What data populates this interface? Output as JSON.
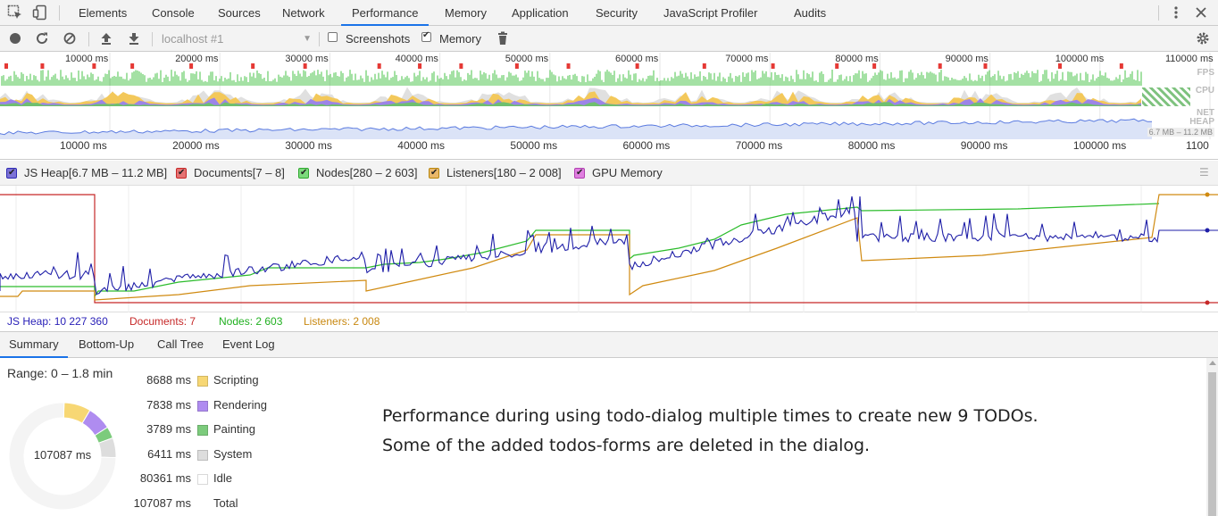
{
  "tabs": [
    {
      "label": "Elements"
    },
    {
      "label": "Console"
    },
    {
      "label": "Sources"
    },
    {
      "label": "Network"
    },
    {
      "label": "Performance"
    },
    {
      "label": "Memory"
    },
    {
      "label": "Application"
    },
    {
      "label": "Security"
    },
    {
      "label": "JavaScript Profiler"
    },
    {
      "label": "Audits"
    }
  ],
  "active_tab": "Performance",
  "toolbar": {
    "target": "localhost #1",
    "screenshots_label": "Screenshots",
    "screenshots_checked": false,
    "memory_label": "Memory",
    "memory_checked": true
  },
  "overview": {
    "ticks": [
      "10000 ms",
      "20000 ms",
      "30000 ms",
      "40000 ms",
      "50000 ms",
      "60000 ms",
      "70000 ms",
      "80000 ms",
      "90000 ms",
      "100000 ms",
      "110000 ms"
    ],
    "bottom_ticks": [
      "10000 ms",
      "20000 ms",
      "30000 ms",
      "40000 ms",
      "50000 ms",
      "60000 ms",
      "70000 ms",
      "80000 ms",
      "90000 ms",
      "100000 ms",
      "1100"
    ],
    "fps_label": "FPS",
    "cpu_label": "CPU",
    "net_label": "NET",
    "heap_label": "HEAP",
    "heap_range": "6.7 MB – 11.2 MB"
  },
  "legend": {
    "items": [
      {
        "label": "JS Heap[6.7 MB – 11.2 MB]",
        "color": "#2e2ab3",
        "checked": true
      },
      {
        "label": "Documents[7 – 8]",
        "color": "#d9534f",
        "checked": true
      },
      {
        "label": "Nodes[280 – 2 603]",
        "color": "#4cd964",
        "checked": true
      },
      {
        "label": "Listeners[180 – 2 008]",
        "color": "#e0a83c",
        "checked": true
      },
      {
        "label": "GPU Memory",
        "color": "#d65bd6",
        "checked": true
      }
    ]
  },
  "counters": {
    "js_heap": "JS Heap: 10 227 360",
    "documents": "Documents: 7",
    "nodes": "Nodes: 2 603",
    "listeners": "Listeners: 2 008"
  },
  "subtabs": [
    "Summary",
    "Bottom-Up",
    "Call Tree",
    "Event Log"
  ],
  "summary": {
    "range": "Range: 0 – 1.8 min",
    "total_center": "107087 ms",
    "rows": [
      {
        "value": "8688 ms",
        "name": "Scripting",
        "color": "#f7d774"
      },
      {
        "value": "7838 ms",
        "name": "Rendering",
        "color": "#af8cf0"
      },
      {
        "value": "3789 ms",
        "name": "Painting",
        "color": "#7ccb7c"
      },
      {
        "value": "6411 ms",
        "name": "System",
        "color": "#dddddd"
      },
      {
        "value": "80361 ms",
        "name": "Idle",
        "color": "#ffffff"
      },
      {
        "value": "107087 ms",
        "name": "Total",
        "color": ""
      }
    ]
  },
  "note": {
    "line1": "Performance during using todo-dialog multiple times to create new 9 TODOs.",
    "line2": "Some of the added todos-forms are deleted in the dialog."
  }
}
